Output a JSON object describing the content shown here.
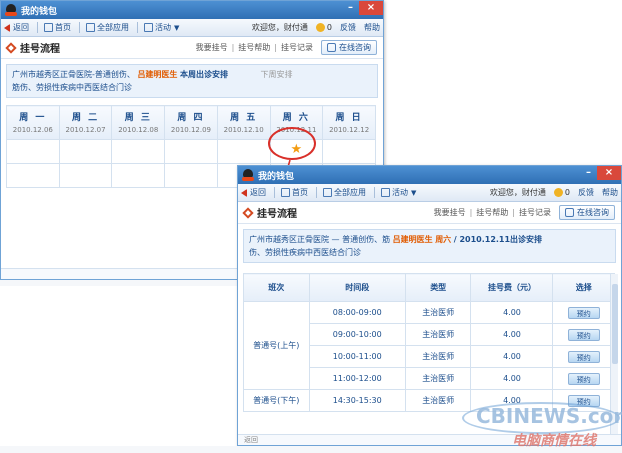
{
  "window1": {
    "title": "我的钱包",
    "toolbar": {
      "back": "返回",
      "home": "首页",
      "all_apps": "全部应用",
      "events": "活动",
      "welcome": "欢迎您，财付通",
      "coins": "0",
      "feedback": "反馈",
      "help": "帮助"
    },
    "header": {
      "title": "挂号流程",
      "step1": "我要挂号",
      "step2": "挂号帮助",
      "step3": "挂号记录",
      "consult": "在线咨询"
    },
    "info": {
      "hospital": "广州市越秀区正骨医院-普通创伤、",
      "doctor": "吕建明医生",
      "this_week": "本周出诊安排",
      "next_week": "下周安排",
      "dept_cont": "筋伤、劳损性疾病中西医结合门诊"
    },
    "calendar": [
      {
        "day": "周 一",
        "date": "2010.12.06"
      },
      {
        "day": "周 二",
        "date": "2010.12.07"
      },
      {
        "day": "周 三",
        "date": "2010.12.08"
      },
      {
        "day": "周 四",
        "date": "2010.12.09"
      },
      {
        "day": "周 五",
        "date": "2010.12.10"
      },
      {
        "day": "周 六",
        "date": "2010.12.11"
      },
      {
        "day": "周 日",
        "date": "2010.12.12"
      }
    ],
    "star_glyph": "★"
  },
  "window2": {
    "title": "我的钱包",
    "toolbar": {
      "back": "返回",
      "home": "首页",
      "all_apps": "全部应用",
      "events": "活动",
      "welcome": "欢迎您，财付通",
      "coins": "0",
      "feedback": "反馈",
      "help": "帮助"
    },
    "header": {
      "title": "挂号流程",
      "step1": "我要挂号",
      "step2": "挂号帮助",
      "step3": "挂号记录",
      "consult": "在线咨询"
    },
    "info": {
      "hospital": "广州市越秀区正骨医院 — 普通创伤、筋",
      "doctor": "吕建明医生",
      "day": "周六",
      "schedule": "/ 2010.12.11出诊安排",
      "dept_cont": "伤、劳损性疾病中西医结合门诊"
    },
    "table": {
      "headers": [
        "班次",
        "时间段",
        "类型",
        "挂号费（元）",
        "选择"
      ],
      "shift": "普通号(上午)",
      "shift2": "普通号(下午)",
      "rows": [
        {
          "time": "08:00-09:00",
          "type": "主治医师",
          "fee": "4.00",
          "action": "预约"
        },
        {
          "time": "09:00-10:00",
          "type": "主治医师",
          "fee": "4.00",
          "action": "预约"
        },
        {
          "time": "10:00-11:00",
          "type": "主治医师",
          "fee": "4.00",
          "action": "预约"
        },
        {
          "time": "11:00-12:00",
          "type": "主治医师",
          "fee": "4.00",
          "action": "预约"
        },
        {
          "time": "14:30-15:30",
          "type": "主治医师",
          "fee": "4.00",
          "action": "预约"
        }
      ]
    },
    "status": "返回"
  },
  "watermark": {
    "brand": "CBINEWS.com",
    "tagline": "电脑商情在线"
  },
  "colors": {
    "titlebar": "#2f6fb4",
    "link": "#1c4e8c",
    "doctor": "#e15b00",
    "highlight_ring": "#d9302a"
  }
}
